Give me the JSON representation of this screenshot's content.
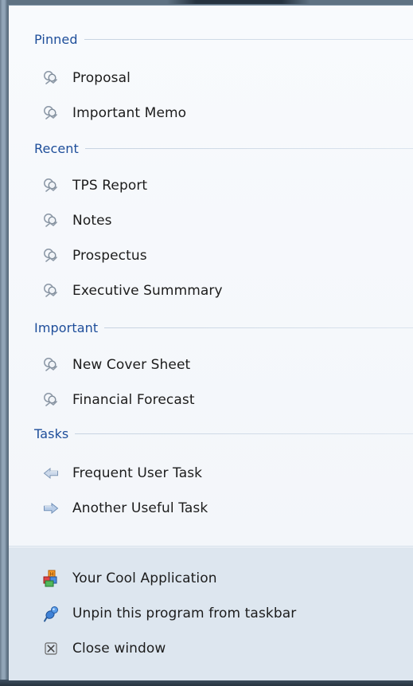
{
  "categories": {
    "pinned": "Pinned",
    "recent": "Recent",
    "important": "Important",
    "tasks": "Tasks"
  },
  "pinned_items": [
    {
      "label": "Proposal",
      "icon": "document-people-icon"
    },
    {
      "label": "Important Memo",
      "icon": "document-people-icon"
    }
  ],
  "recent_items": [
    {
      "label": "TPS Report",
      "icon": "document-people-icon"
    },
    {
      "label": "Notes",
      "icon": "document-people-icon"
    },
    {
      "label": "Prospectus",
      "icon": "document-people-icon"
    },
    {
      "label": "Executive Summmary",
      "icon": "document-people-icon"
    }
  ],
  "important_items": [
    {
      "label": "New Cover Sheet",
      "icon": "document-people-icon"
    },
    {
      "label": "Financial Forecast",
      "icon": "document-people-icon"
    }
  ],
  "tasks": [
    {
      "label": "Frequent User Task",
      "icon": "arrow-left-icon"
    },
    {
      "label": "Another Useful Task",
      "icon": "arrow-right-icon"
    }
  ],
  "footer": {
    "app": {
      "label": "Your Cool Application",
      "icon": "app-blocks-icon"
    },
    "unpin": {
      "label": "Unpin this program from taskbar",
      "icon": "pin-icon"
    },
    "close": {
      "label": "Close window",
      "icon": "close-icon"
    }
  },
  "colors": {
    "category_text": "#1e4e9a",
    "item_text": "#1c1c1c",
    "list_background": "#f4f7fb",
    "footer_background": "#dde6ef"
  }
}
